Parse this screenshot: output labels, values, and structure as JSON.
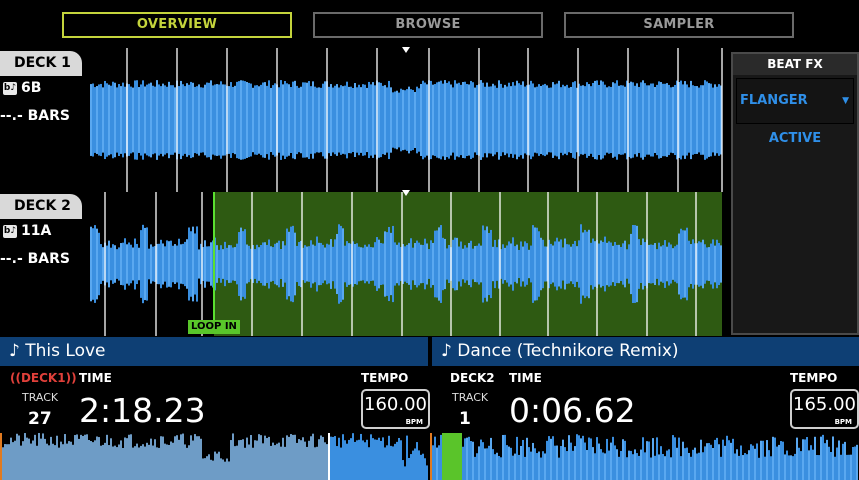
{
  "tabs": [
    {
      "label": "OVERVIEW",
      "active": true
    },
    {
      "label": "BROWSE",
      "active": false
    },
    {
      "label": "SAMPLER",
      "active": false
    }
  ],
  "decks": [
    {
      "label": "DECK 1",
      "key": "6B",
      "bars": "--.- BARS"
    },
    {
      "label": "DECK 2",
      "key": "11A",
      "bars": "--.- BARS"
    }
  ],
  "loop_label": "LOOP IN",
  "beat_fx": {
    "title": "BEAT FX",
    "effect": "FLANGER",
    "status": "ACTIVE"
  },
  "players": [
    {
      "title": "This Love",
      "deck": "DECK1",
      "playing": true,
      "track_label": "TRACK",
      "track": "27",
      "time_label": "TIME",
      "time": "2:18.23",
      "tempo_label": "TEMPO",
      "tempo": "160.00",
      "unit": "BPM"
    },
    {
      "title": "Dance (Technikore Remix)",
      "deck": "DECK2",
      "playing": false,
      "track_label": "TRACK",
      "track": "1",
      "time_label": "TIME",
      "time": "0:06.62",
      "tempo_label": "TEMPO",
      "tempo": "165.00",
      "unit": "BPM"
    }
  ],
  "icons": {
    "note": "music-note-icon",
    "key": "key-icon",
    "dropdown": "dropdown-arrow-icon"
  },
  "colors": {
    "accent": "#c4d43c",
    "wave_blue": "#3a8fe0",
    "loop_green": "#2e5a12",
    "title_bar": "#0e3f74",
    "playing_red": "#e0403a"
  }
}
